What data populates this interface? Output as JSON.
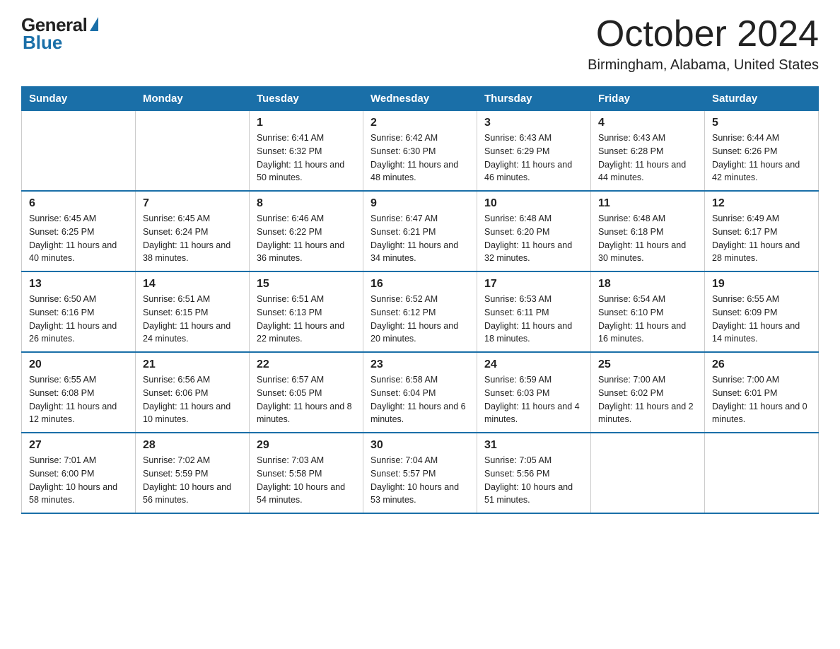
{
  "header": {
    "logo_general": "General",
    "logo_blue": "Blue",
    "month_title": "October 2024",
    "location": "Birmingham, Alabama, United States"
  },
  "days_of_week": [
    "Sunday",
    "Monday",
    "Tuesday",
    "Wednesday",
    "Thursday",
    "Friday",
    "Saturday"
  ],
  "weeks": [
    [
      {
        "day": "",
        "sunrise": "",
        "sunset": "",
        "daylight": ""
      },
      {
        "day": "",
        "sunrise": "",
        "sunset": "",
        "daylight": ""
      },
      {
        "day": "1",
        "sunrise": "Sunrise: 6:41 AM",
        "sunset": "Sunset: 6:32 PM",
        "daylight": "Daylight: 11 hours and 50 minutes."
      },
      {
        "day": "2",
        "sunrise": "Sunrise: 6:42 AM",
        "sunset": "Sunset: 6:30 PM",
        "daylight": "Daylight: 11 hours and 48 minutes."
      },
      {
        "day": "3",
        "sunrise": "Sunrise: 6:43 AM",
        "sunset": "Sunset: 6:29 PM",
        "daylight": "Daylight: 11 hours and 46 minutes."
      },
      {
        "day": "4",
        "sunrise": "Sunrise: 6:43 AM",
        "sunset": "Sunset: 6:28 PM",
        "daylight": "Daylight: 11 hours and 44 minutes."
      },
      {
        "day": "5",
        "sunrise": "Sunrise: 6:44 AM",
        "sunset": "Sunset: 6:26 PM",
        "daylight": "Daylight: 11 hours and 42 minutes."
      }
    ],
    [
      {
        "day": "6",
        "sunrise": "Sunrise: 6:45 AM",
        "sunset": "Sunset: 6:25 PM",
        "daylight": "Daylight: 11 hours and 40 minutes."
      },
      {
        "day": "7",
        "sunrise": "Sunrise: 6:45 AM",
        "sunset": "Sunset: 6:24 PM",
        "daylight": "Daylight: 11 hours and 38 minutes."
      },
      {
        "day": "8",
        "sunrise": "Sunrise: 6:46 AM",
        "sunset": "Sunset: 6:22 PM",
        "daylight": "Daylight: 11 hours and 36 minutes."
      },
      {
        "day": "9",
        "sunrise": "Sunrise: 6:47 AM",
        "sunset": "Sunset: 6:21 PM",
        "daylight": "Daylight: 11 hours and 34 minutes."
      },
      {
        "day": "10",
        "sunrise": "Sunrise: 6:48 AM",
        "sunset": "Sunset: 6:20 PM",
        "daylight": "Daylight: 11 hours and 32 minutes."
      },
      {
        "day": "11",
        "sunrise": "Sunrise: 6:48 AM",
        "sunset": "Sunset: 6:18 PM",
        "daylight": "Daylight: 11 hours and 30 minutes."
      },
      {
        "day": "12",
        "sunrise": "Sunrise: 6:49 AM",
        "sunset": "Sunset: 6:17 PM",
        "daylight": "Daylight: 11 hours and 28 minutes."
      }
    ],
    [
      {
        "day": "13",
        "sunrise": "Sunrise: 6:50 AM",
        "sunset": "Sunset: 6:16 PM",
        "daylight": "Daylight: 11 hours and 26 minutes."
      },
      {
        "day": "14",
        "sunrise": "Sunrise: 6:51 AM",
        "sunset": "Sunset: 6:15 PM",
        "daylight": "Daylight: 11 hours and 24 minutes."
      },
      {
        "day": "15",
        "sunrise": "Sunrise: 6:51 AM",
        "sunset": "Sunset: 6:13 PM",
        "daylight": "Daylight: 11 hours and 22 minutes."
      },
      {
        "day": "16",
        "sunrise": "Sunrise: 6:52 AM",
        "sunset": "Sunset: 6:12 PM",
        "daylight": "Daylight: 11 hours and 20 minutes."
      },
      {
        "day": "17",
        "sunrise": "Sunrise: 6:53 AM",
        "sunset": "Sunset: 6:11 PM",
        "daylight": "Daylight: 11 hours and 18 minutes."
      },
      {
        "day": "18",
        "sunrise": "Sunrise: 6:54 AM",
        "sunset": "Sunset: 6:10 PM",
        "daylight": "Daylight: 11 hours and 16 minutes."
      },
      {
        "day": "19",
        "sunrise": "Sunrise: 6:55 AM",
        "sunset": "Sunset: 6:09 PM",
        "daylight": "Daylight: 11 hours and 14 minutes."
      }
    ],
    [
      {
        "day": "20",
        "sunrise": "Sunrise: 6:55 AM",
        "sunset": "Sunset: 6:08 PM",
        "daylight": "Daylight: 11 hours and 12 minutes."
      },
      {
        "day": "21",
        "sunrise": "Sunrise: 6:56 AM",
        "sunset": "Sunset: 6:06 PM",
        "daylight": "Daylight: 11 hours and 10 minutes."
      },
      {
        "day": "22",
        "sunrise": "Sunrise: 6:57 AM",
        "sunset": "Sunset: 6:05 PM",
        "daylight": "Daylight: 11 hours and 8 minutes."
      },
      {
        "day": "23",
        "sunrise": "Sunrise: 6:58 AM",
        "sunset": "Sunset: 6:04 PM",
        "daylight": "Daylight: 11 hours and 6 minutes."
      },
      {
        "day": "24",
        "sunrise": "Sunrise: 6:59 AM",
        "sunset": "Sunset: 6:03 PM",
        "daylight": "Daylight: 11 hours and 4 minutes."
      },
      {
        "day": "25",
        "sunrise": "Sunrise: 7:00 AM",
        "sunset": "Sunset: 6:02 PM",
        "daylight": "Daylight: 11 hours and 2 minutes."
      },
      {
        "day": "26",
        "sunrise": "Sunrise: 7:00 AM",
        "sunset": "Sunset: 6:01 PM",
        "daylight": "Daylight: 11 hours and 0 minutes."
      }
    ],
    [
      {
        "day": "27",
        "sunrise": "Sunrise: 7:01 AM",
        "sunset": "Sunset: 6:00 PM",
        "daylight": "Daylight: 10 hours and 58 minutes."
      },
      {
        "day": "28",
        "sunrise": "Sunrise: 7:02 AM",
        "sunset": "Sunset: 5:59 PM",
        "daylight": "Daylight: 10 hours and 56 minutes."
      },
      {
        "day": "29",
        "sunrise": "Sunrise: 7:03 AM",
        "sunset": "Sunset: 5:58 PM",
        "daylight": "Daylight: 10 hours and 54 minutes."
      },
      {
        "day": "30",
        "sunrise": "Sunrise: 7:04 AM",
        "sunset": "Sunset: 5:57 PM",
        "daylight": "Daylight: 10 hours and 53 minutes."
      },
      {
        "day": "31",
        "sunrise": "Sunrise: 7:05 AM",
        "sunset": "Sunset: 5:56 PM",
        "daylight": "Daylight: 10 hours and 51 minutes."
      },
      {
        "day": "",
        "sunrise": "",
        "sunset": "",
        "daylight": ""
      },
      {
        "day": "",
        "sunrise": "",
        "sunset": "",
        "daylight": ""
      }
    ]
  ]
}
